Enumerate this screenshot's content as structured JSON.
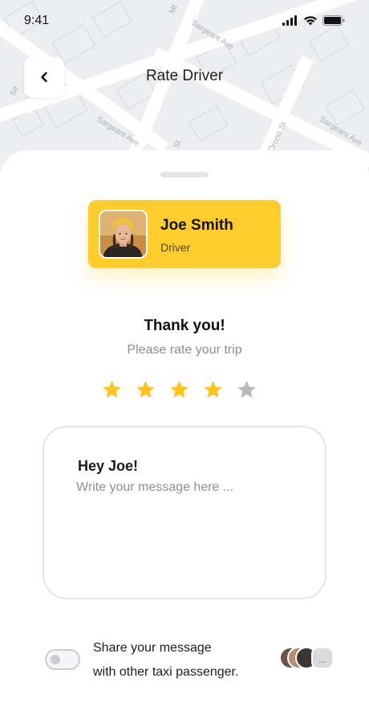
{
  "status_bar": {
    "time": "9:41",
    "icons": [
      "cellular-signal-icon",
      "wifi-icon",
      "battery-icon"
    ]
  },
  "map": {
    "street_labels": [
      "Mt",
      "Sargeant Ave",
      "Sargeant Ave",
      "Sargeant Ave",
      "Orono St",
      "St",
      "Se"
    ]
  },
  "header": {
    "title": "Rate Driver",
    "back_icon": "chevron-left-icon"
  },
  "driver": {
    "name": "Joe Smith",
    "role": "Driver"
  },
  "rating": {
    "title": "Thank you!",
    "subtitle": "Please rate your trip",
    "value": 4,
    "max": 5,
    "filled_color": "#FFC21F",
    "empty_color": "#B5B9C2"
  },
  "message": {
    "greeting": "Hey Joe!",
    "placeholder": "Write your message here ...",
    "value": ""
  },
  "share": {
    "line1": "Share your message",
    "line2": "with other taxi passenger.",
    "enabled": false,
    "more_label": "..."
  },
  "colors": {
    "accent": "#FFCC2E",
    "text": "#1D1D1F",
    "muted": "#8A8D94"
  }
}
